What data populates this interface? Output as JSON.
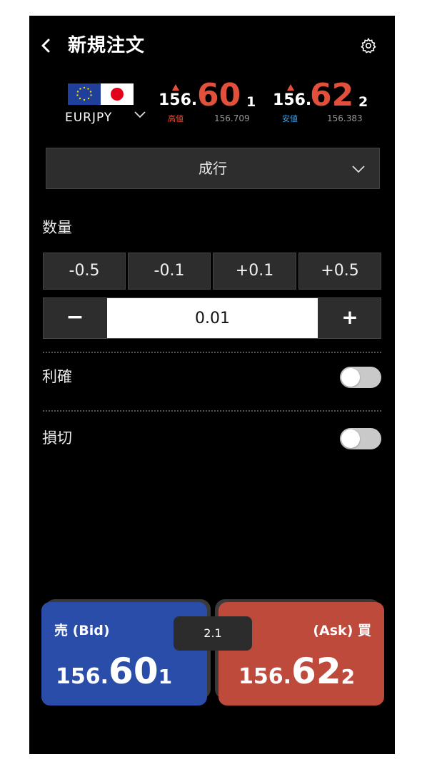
{
  "header": {
    "title": "新規注文",
    "back_icon": "chevron-left-icon",
    "settings_icon": "gear-icon"
  },
  "pair": {
    "symbol": "EURJPY",
    "base_flag": "eu-flag-icon",
    "quote_flag": "jp-flag-icon"
  },
  "quotes": {
    "bid": {
      "prefix": "156.",
      "big": "60",
      "pip": "1",
      "tag": "高値",
      "ref": "156.709"
    },
    "ask": {
      "prefix": "156.",
      "big": "62",
      "pip": "2",
      "tag": "安値",
      "ref": "156.383"
    }
  },
  "order_type": {
    "label": "成行"
  },
  "quantity": {
    "label": "数量",
    "presets": [
      "-0.5",
      "-0.1",
      "+0.1",
      "+0.5"
    ],
    "minus": "−",
    "value": "0.01",
    "plus": "+"
  },
  "take_profit": {
    "label": "利確",
    "enabled": false
  },
  "stop_loss": {
    "label": "損切",
    "enabled": false
  },
  "trade": {
    "bid_label": "売 (Bid)",
    "ask_label": "(Ask) 買",
    "bid_prefix": "156.",
    "bid_big": "60",
    "bid_pip": "1",
    "ask_prefix": "156.",
    "ask_big": "62",
    "ask_pip": "2",
    "spread": "2.1"
  },
  "colors": {
    "background": "#000000",
    "bid": "#2b4daa",
    "ask": "#be4a3c",
    "price_red": "#e2503c",
    "low_tag": "#3aa0e8",
    "high_tag": "#e2503c",
    "panel": "#2d2d2d"
  }
}
